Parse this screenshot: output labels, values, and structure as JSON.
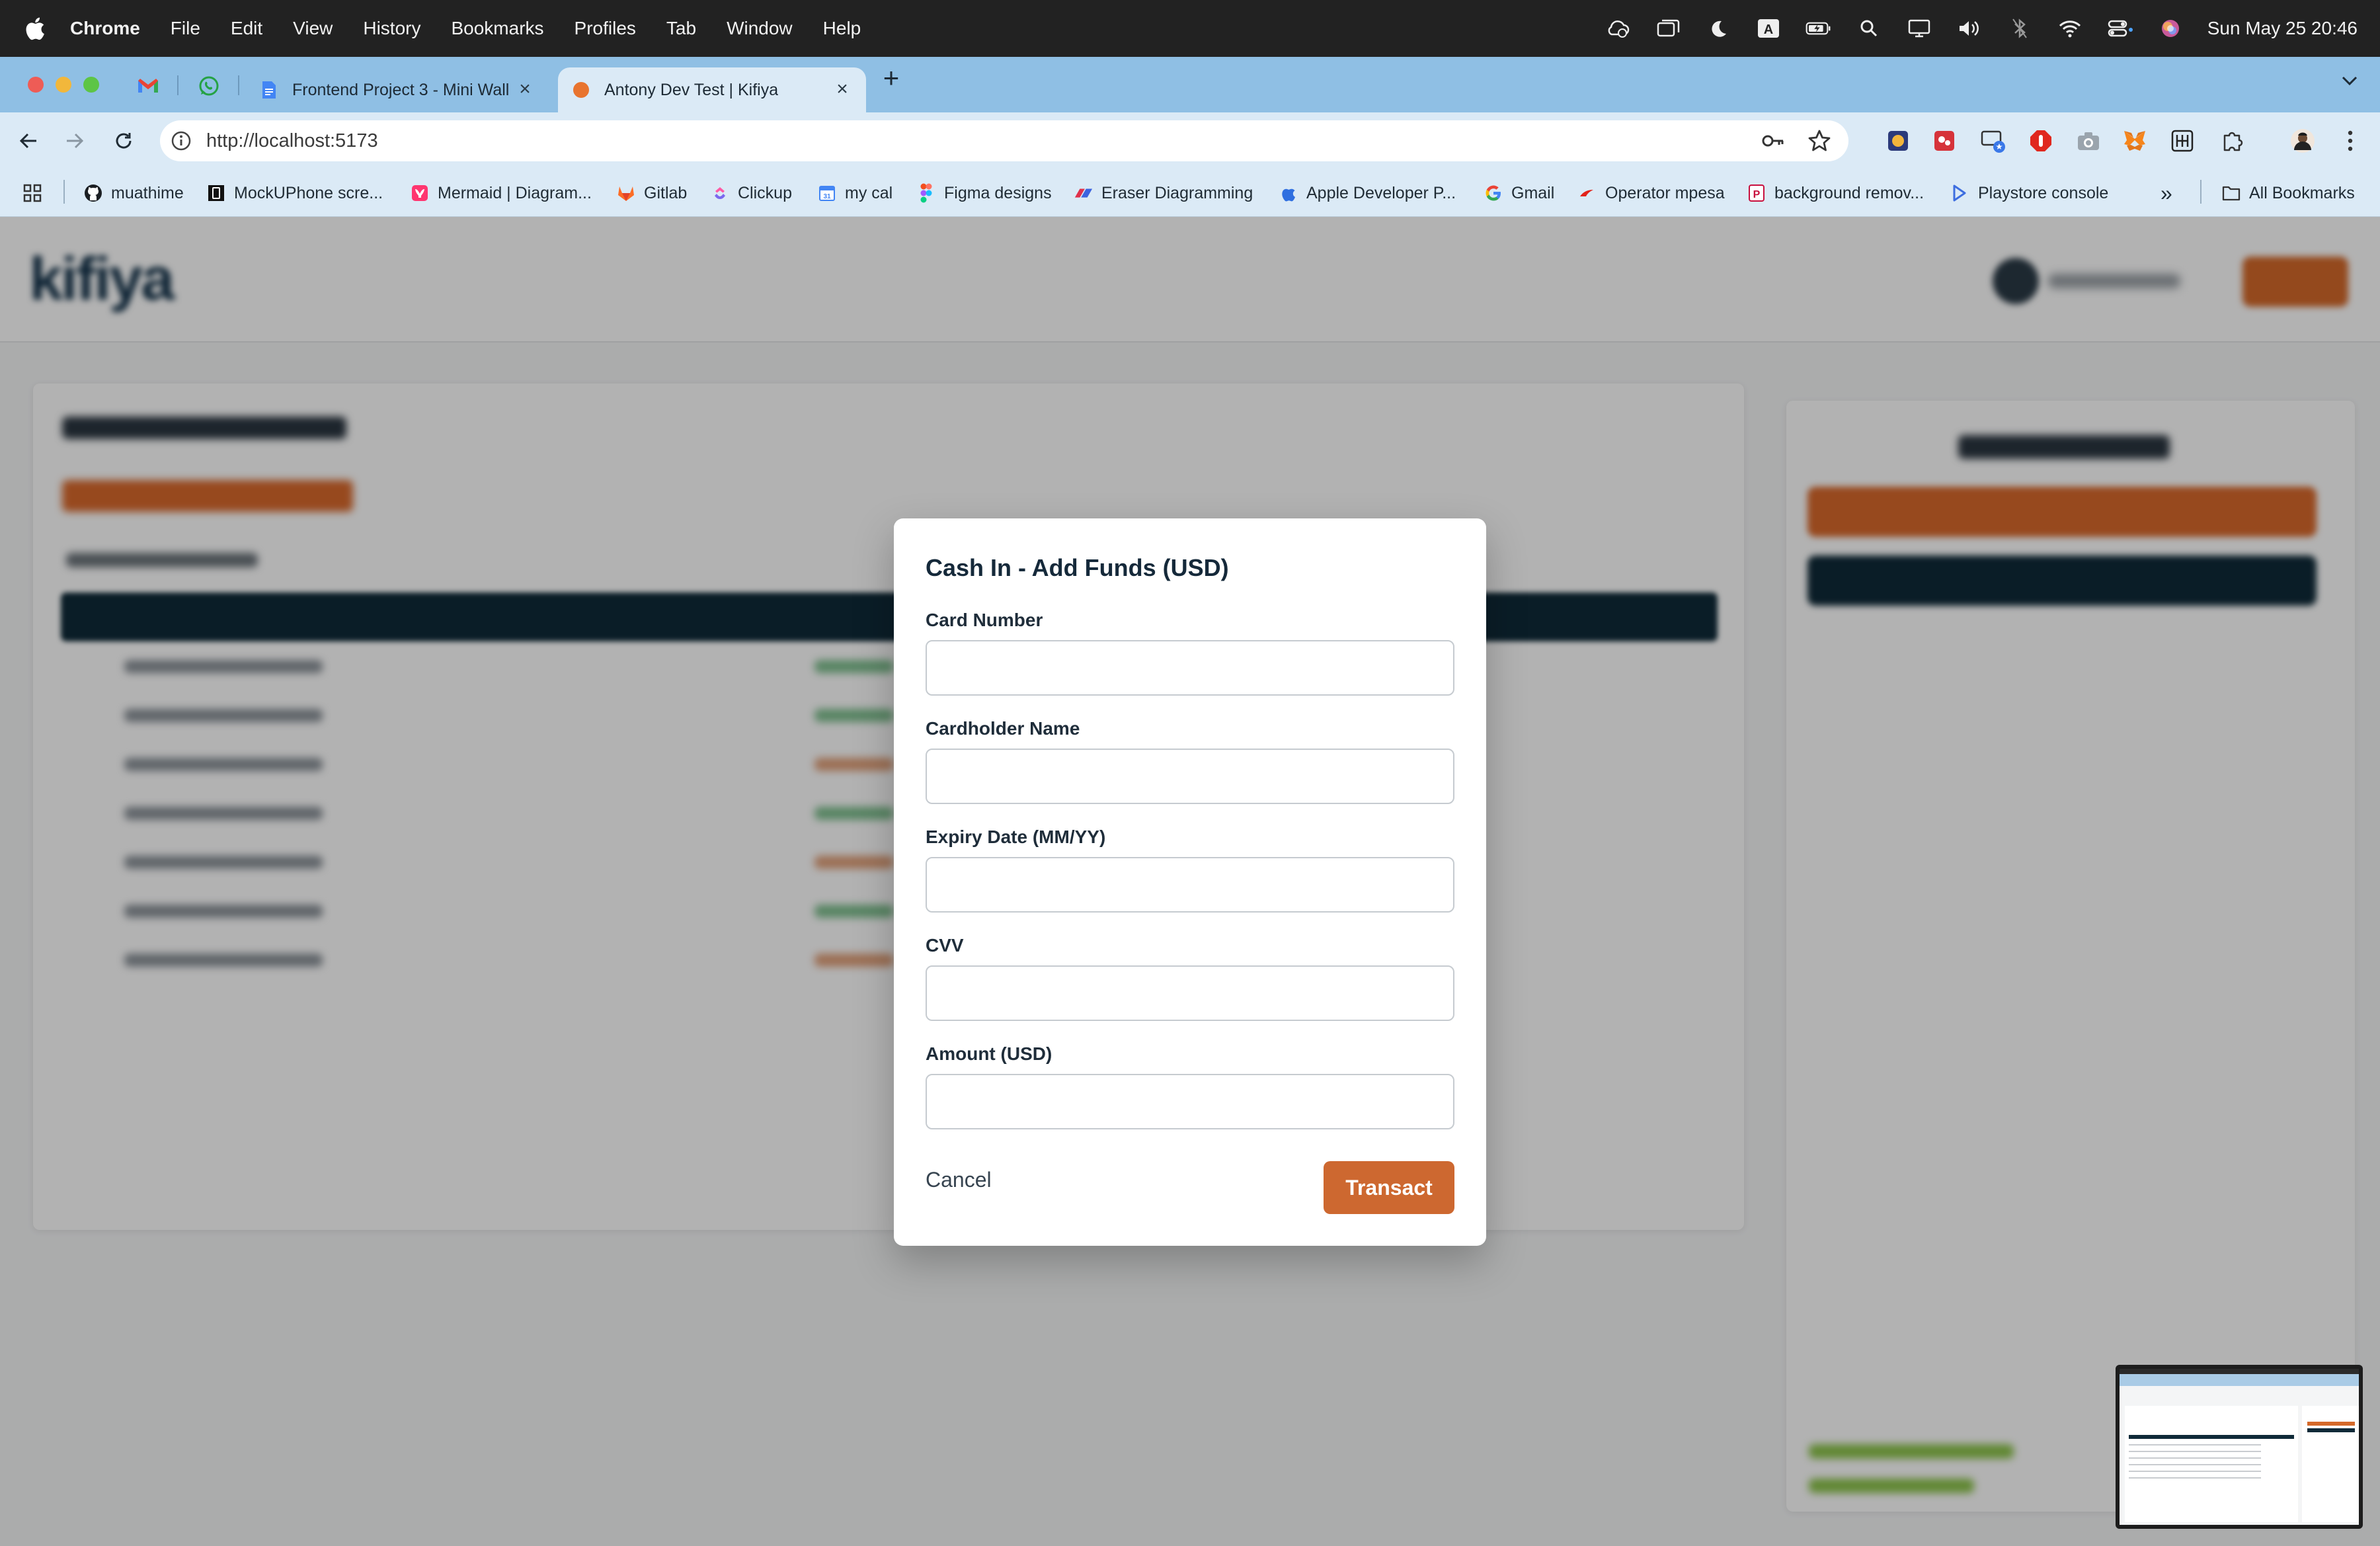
{
  "menubar": {
    "app_name": "Chrome",
    "items": [
      "File",
      "Edit",
      "View",
      "History",
      "Bookmarks",
      "Profiles",
      "Tab",
      "Window",
      "Help"
    ],
    "clock": "Sun May 25  20:46",
    "status_icons": [
      "cloud-icon",
      "window-icon",
      "moon-icon",
      "input-source-icon",
      "battery-icon",
      "search-icon",
      "display-icon",
      "volume-icon",
      "bluetooth-icon",
      "wifi-icon",
      "control-center-icon",
      "siri-icon"
    ]
  },
  "tabs": [
    {
      "title": "Frontend Project 3 - Mini Wall",
      "icon": "docs-icon",
      "active": false
    },
    {
      "title": "Antony Dev Test | Kifiya",
      "icon": "kifiya-icon",
      "active": true
    }
  ],
  "pinned_tabs": [
    "gmail-icon",
    "whatsapp-icon"
  ],
  "toolbar": {
    "url": "http://localhost:5173"
  },
  "bookmarks": [
    {
      "label": "muathime",
      "icon": "github-icon"
    },
    {
      "label": "MockUPhone scre...",
      "icon": "mockuphone-icon"
    },
    {
      "label": "Mermaid | Diagram...",
      "icon": "mermaid-icon"
    },
    {
      "label": "Gitlab",
      "icon": "gitlab-icon"
    },
    {
      "label": "Clickup",
      "icon": "clickup-icon"
    },
    {
      "label": "my cal",
      "icon": "calendar-icon"
    },
    {
      "label": "Figma designs",
      "icon": "figma-icon"
    },
    {
      "label": "Eraser Diagramming",
      "icon": "eraser-icon"
    },
    {
      "label": "Apple Developer P...",
      "icon": "apple-icon"
    },
    {
      "label": "Gmail",
      "icon": "google-icon"
    },
    {
      "label": "Operator mpesa",
      "icon": "mpesa-icon"
    },
    {
      "label": "background remov...",
      "icon": "removebg-icon"
    },
    {
      "label": "Playstore console",
      "icon": "playstore-icon"
    }
  ],
  "bookmarks_more": "»",
  "all_bookmarks": "All Bookmarks",
  "modal": {
    "title": "Cash In - Add Funds (USD)",
    "fields": [
      {
        "label": "Card Number",
        "value": "",
        "placeholder": ""
      },
      {
        "label": "Cardholder Name",
        "value": "",
        "placeholder": ""
      },
      {
        "label": "Expiry Date (MM/YY)",
        "value": "",
        "placeholder": ""
      },
      {
        "label": "CVV",
        "value": "",
        "placeholder": ""
      },
      {
        "label": "Amount (USD)",
        "value": "",
        "placeholder": ""
      }
    ],
    "cancel_label": "Cancel",
    "submit_label": "Transact"
  },
  "colors": {
    "accent": "#cd6830",
    "dark": "#0f2a38",
    "tabstrip": "#8fbfe4",
    "toolbar": "#dbeaf6"
  }
}
